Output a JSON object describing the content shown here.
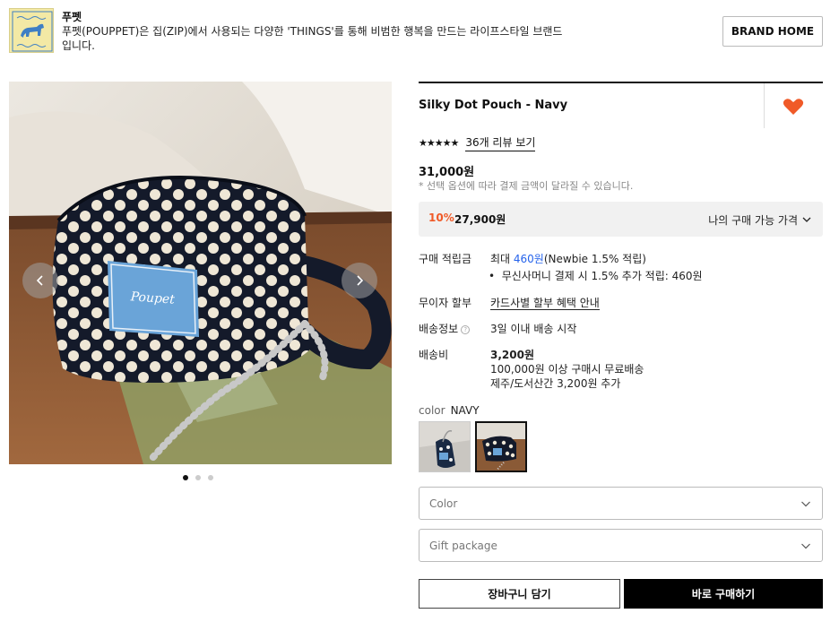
{
  "brand": {
    "name": "푸펫",
    "description": "푸펫(POUPPET)은 집(ZIP)에서 사용되는 다양한 'THINGS'를 통해 비범한 행복을 만드는 라이프스타일 브랜드입니다.",
    "home_button": "BRAND HOME",
    "logo_icon": "horse-logo-icon",
    "label_on_bag": "Poupet"
  },
  "product": {
    "title": "Silky Dot Pouch - Navy",
    "rating_stars": "★★★★★",
    "rating_value": 5,
    "review_link": "36개 리뷰 보기",
    "price": "31,000원",
    "price_note": "* 선택 옵션에 따라 결제 금액이 달라질 수 있습니다.",
    "wishlisted": true,
    "heart_color": "#f05a28"
  },
  "my_price": {
    "discount": "10%",
    "discount_price": "27,900원",
    "label": "나의 구매 가능 가격"
  },
  "info": {
    "points_label": "구매 적립금",
    "points_prefix": "최대 ",
    "points_amount": "460원",
    "points_suffix": "(Newbie 1.5% 적립)",
    "points_bullet": "무신사머니 결제 시 1.5% 추가 적립: 460원",
    "installment_label": "무이자 할부",
    "installment_link": "카드사별 할부 혜택 안내",
    "delivery_label": "배송정보",
    "delivery_value": "3일 이내 배송 시작",
    "shipping_label": "배송비",
    "shipping_fee": "3,200원",
    "shipping_free": "100,000원 이상 구매시 무료배송",
    "shipping_extra": "제주/도서산간 3,200원 추가"
  },
  "color_option": {
    "label": "color",
    "selected": "NAVY",
    "swatch_count": 2,
    "selected_index": 1
  },
  "selects": {
    "color_placeholder": "Color",
    "gift_placeholder": "Gift package"
  },
  "buttons": {
    "cart": "장바구니 담기",
    "buy": "바로 구매하기"
  },
  "gallery": {
    "image_count": 3,
    "current_index": 0
  },
  "colors": {
    "accent_orange": "#f05a28",
    "points_blue": "#2563eb",
    "bag_navy": "#141a2a"
  }
}
